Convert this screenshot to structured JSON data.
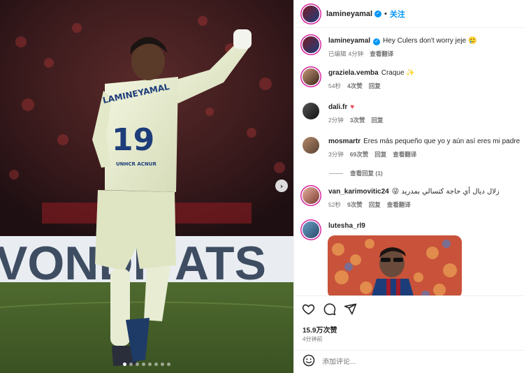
{
  "post": {
    "username": "lamineyamal",
    "follow_label": "关注",
    "separator": "•",
    "jersey_name": "LAMINEYAMAL",
    "jersey_number": "19",
    "sponsor": "UNHCR ACNUR",
    "caption": {
      "username": "lamineyamal",
      "text": "Hey Culers don't worry jeje 🥲",
      "edited": "已编辑",
      "time": "4分钟",
      "translate": "查看翻译"
    },
    "comments": [
      {
        "username": "graziela.vemba",
        "text": "Craque ✨",
        "time": "54秒",
        "likes": "4次赞",
        "reply": "回复",
        "translate": ""
      },
      {
        "username": "dali.fr",
        "text": "♥",
        "time": "2分钟",
        "likes": "3次赞",
        "reply": "回复",
        "translate": ""
      },
      {
        "username": "mosmartr",
        "text": "Eres más pequeño que yo y aún así eres mi padre",
        "time": "3分钟",
        "likes": "69次赞",
        "reply": "回复",
        "translate": "查看翻译"
      },
      {
        "username": "van_karimovitic24",
        "text": "😜 زلال ديال أي حاجة كتسالي بمدريد",
        "time": "52秒",
        "likes": "9次赞",
        "reply": "回复",
        "translate": "查看翻译"
      },
      {
        "username": "lutesha_rl9",
        "text": "",
        "time": "",
        "likes": "",
        "reply": "",
        "translate": ""
      }
    ],
    "view_replies": "查看回复 (1)",
    "likes_count": "15.9万次赞",
    "posted_time": "4分钟前",
    "comment_placeholder": "添加评论..."
  },
  "icons": {
    "like": "heart-icon",
    "comment": "comment-icon",
    "share": "share-icon",
    "emoji": "emoji-icon",
    "verified": "verified-badge-icon",
    "next": "chevron-right-icon"
  },
  "colors": {
    "accent": "#0095f6",
    "heart": "#ed4956",
    "muted": "#737373",
    "text": "#262626"
  }
}
